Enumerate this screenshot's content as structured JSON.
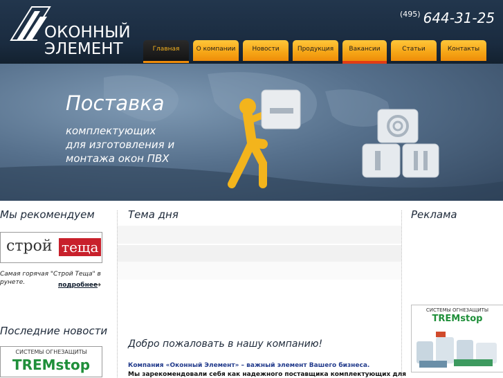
{
  "header": {
    "logo": {
      "line1": "ОКОННЫЙ",
      "line2": "ЭЛЕМЕНТ"
    },
    "phone": {
      "code": "(495)",
      "number": "644-31-25"
    }
  },
  "nav": {
    "items": [
      {
        "label": "Главная"
      },
      {
        "label": "О компании"
      },
      {
        "label": "Новости"
      },
      {
        "label": "Продукция"
      },
      {
        "label": "Вакансии"
      },
      {
        "label": "Статьи"
      },
      {
        "label": "Контакты"
      }
    ],
    "active_label": "Главная"
  },
  "banner": {
    "title": "Поставка",
    "subtitle_lines": [
      "комплектующих",
      "для изготовления и",
      "монтажа окон ПВХ"
    ]
  },
  "left": {
    "recommend_title": "Мы рекомендуем",
    "recommend_logo": {
      "part1": "строй",
      "part2": "теща"
    },
    "recommend_text_line1": "Самая горячая \"Строй Теща\" в",
    "recommend_text_line2": "рунете.",
    "more_label": "подробнее",
    "news_title": "Последние новости",
    "news_logo": {
      "caption": "СИСТЕМЫ ОГНЕЗАЩИТЫ",
      "brand": "TREMstop"
    }
  },
  "center": {
    "topic_title": "Тема дня",
    "welcome": "Добро пожаловать в нашу компанию!",
    "para1": "Компания «Оконный Элемент» – важный элемент Вашего бизнеса.",
    "para2": "Мы зарекомендовали себя как надежного поставщика комплектующих для"
  },
  "right": {
    "ad_title": "Реклама",
    "ad_logo": {
      "caption": "СИСТЕМЫ ОГНЕЗАЩИТЫ",
      "brand": "TREMstop"
    }
  },
  "colors": {
    "header_bg": "#1a2b3f",
    "nav_orange": "#f6a516",
    "nav_active": "#141414",
    "accent_red": "#c8202b",
    "text_dark": "#1d2939",
    "link_blue": "#223b8c"
  }
}
